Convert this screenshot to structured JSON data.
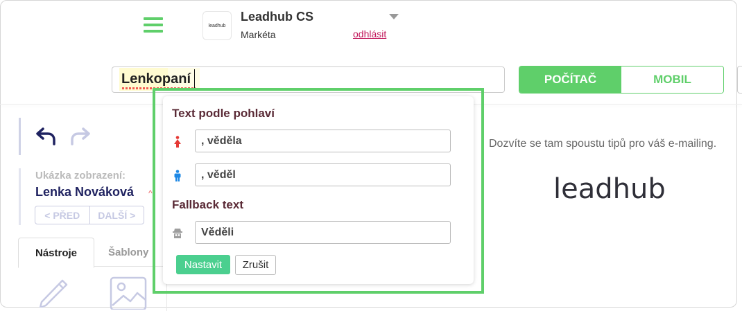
{
  "header": {
    "account_name": "Leadhub CS",
    "user_name": "Markéta",
    "logout_label": "odhlásit",
    "logo_text": "leadhub"
  },
  "subject": {
    "value": "Lenkopaní"
  },
  "device_toggle": {
    "desktop_label": "POČÍTAČ",
    "mobile_label": "MOBIL",
    "selected": "POČÍTAČ"
  },
  "preview": {
    "label": "Ukázka zobrazení:",
    "name": "Lenka Nováková",
    "prev_label": "< PŘED",
    "next_label": "DALŠÍ >"
  },
  "tabs": {
    "tools": "Nástroje",
    "templates": "Šablony"
  },
  "canvas": {
    "text": "Dozvíte se tam spoustu tipů pro váš e-mailing.",
    "logo_text": "leadhub"
  },
  "popup": {
    "title": "Text podle pohlaví",
    "female_value": ", věděla",
    "male_value": ", věděl",
    "fallback_title": "Fallback text",
    "fallback_value": "Věděli",
    "set_label": "Nastavit",
    "cancel_label": "Zrušit"
  },
  "colors": {
    "accent_green": "#5fcf6a",
    "button_green": "#4bcf8f",
    "heading_maroon": "#5a2a36",
    "female_icon": "#e53935",
    "male_icon": "#1e88e5",
    "neutral_icon": "#9e9e9e",
    "logout_link": "#c2185b"
  },
  "icons": {
    "menu": "hamburger-icon",
    "undo": "undo-icon",
    "redo": "redo-icon",
    "female": "female-icon",
    "male": "male-icon",
    "fallback": "incognito-icon",
    "pencil": "pencil-icon",
    "image": "image-icon"
  }
}
